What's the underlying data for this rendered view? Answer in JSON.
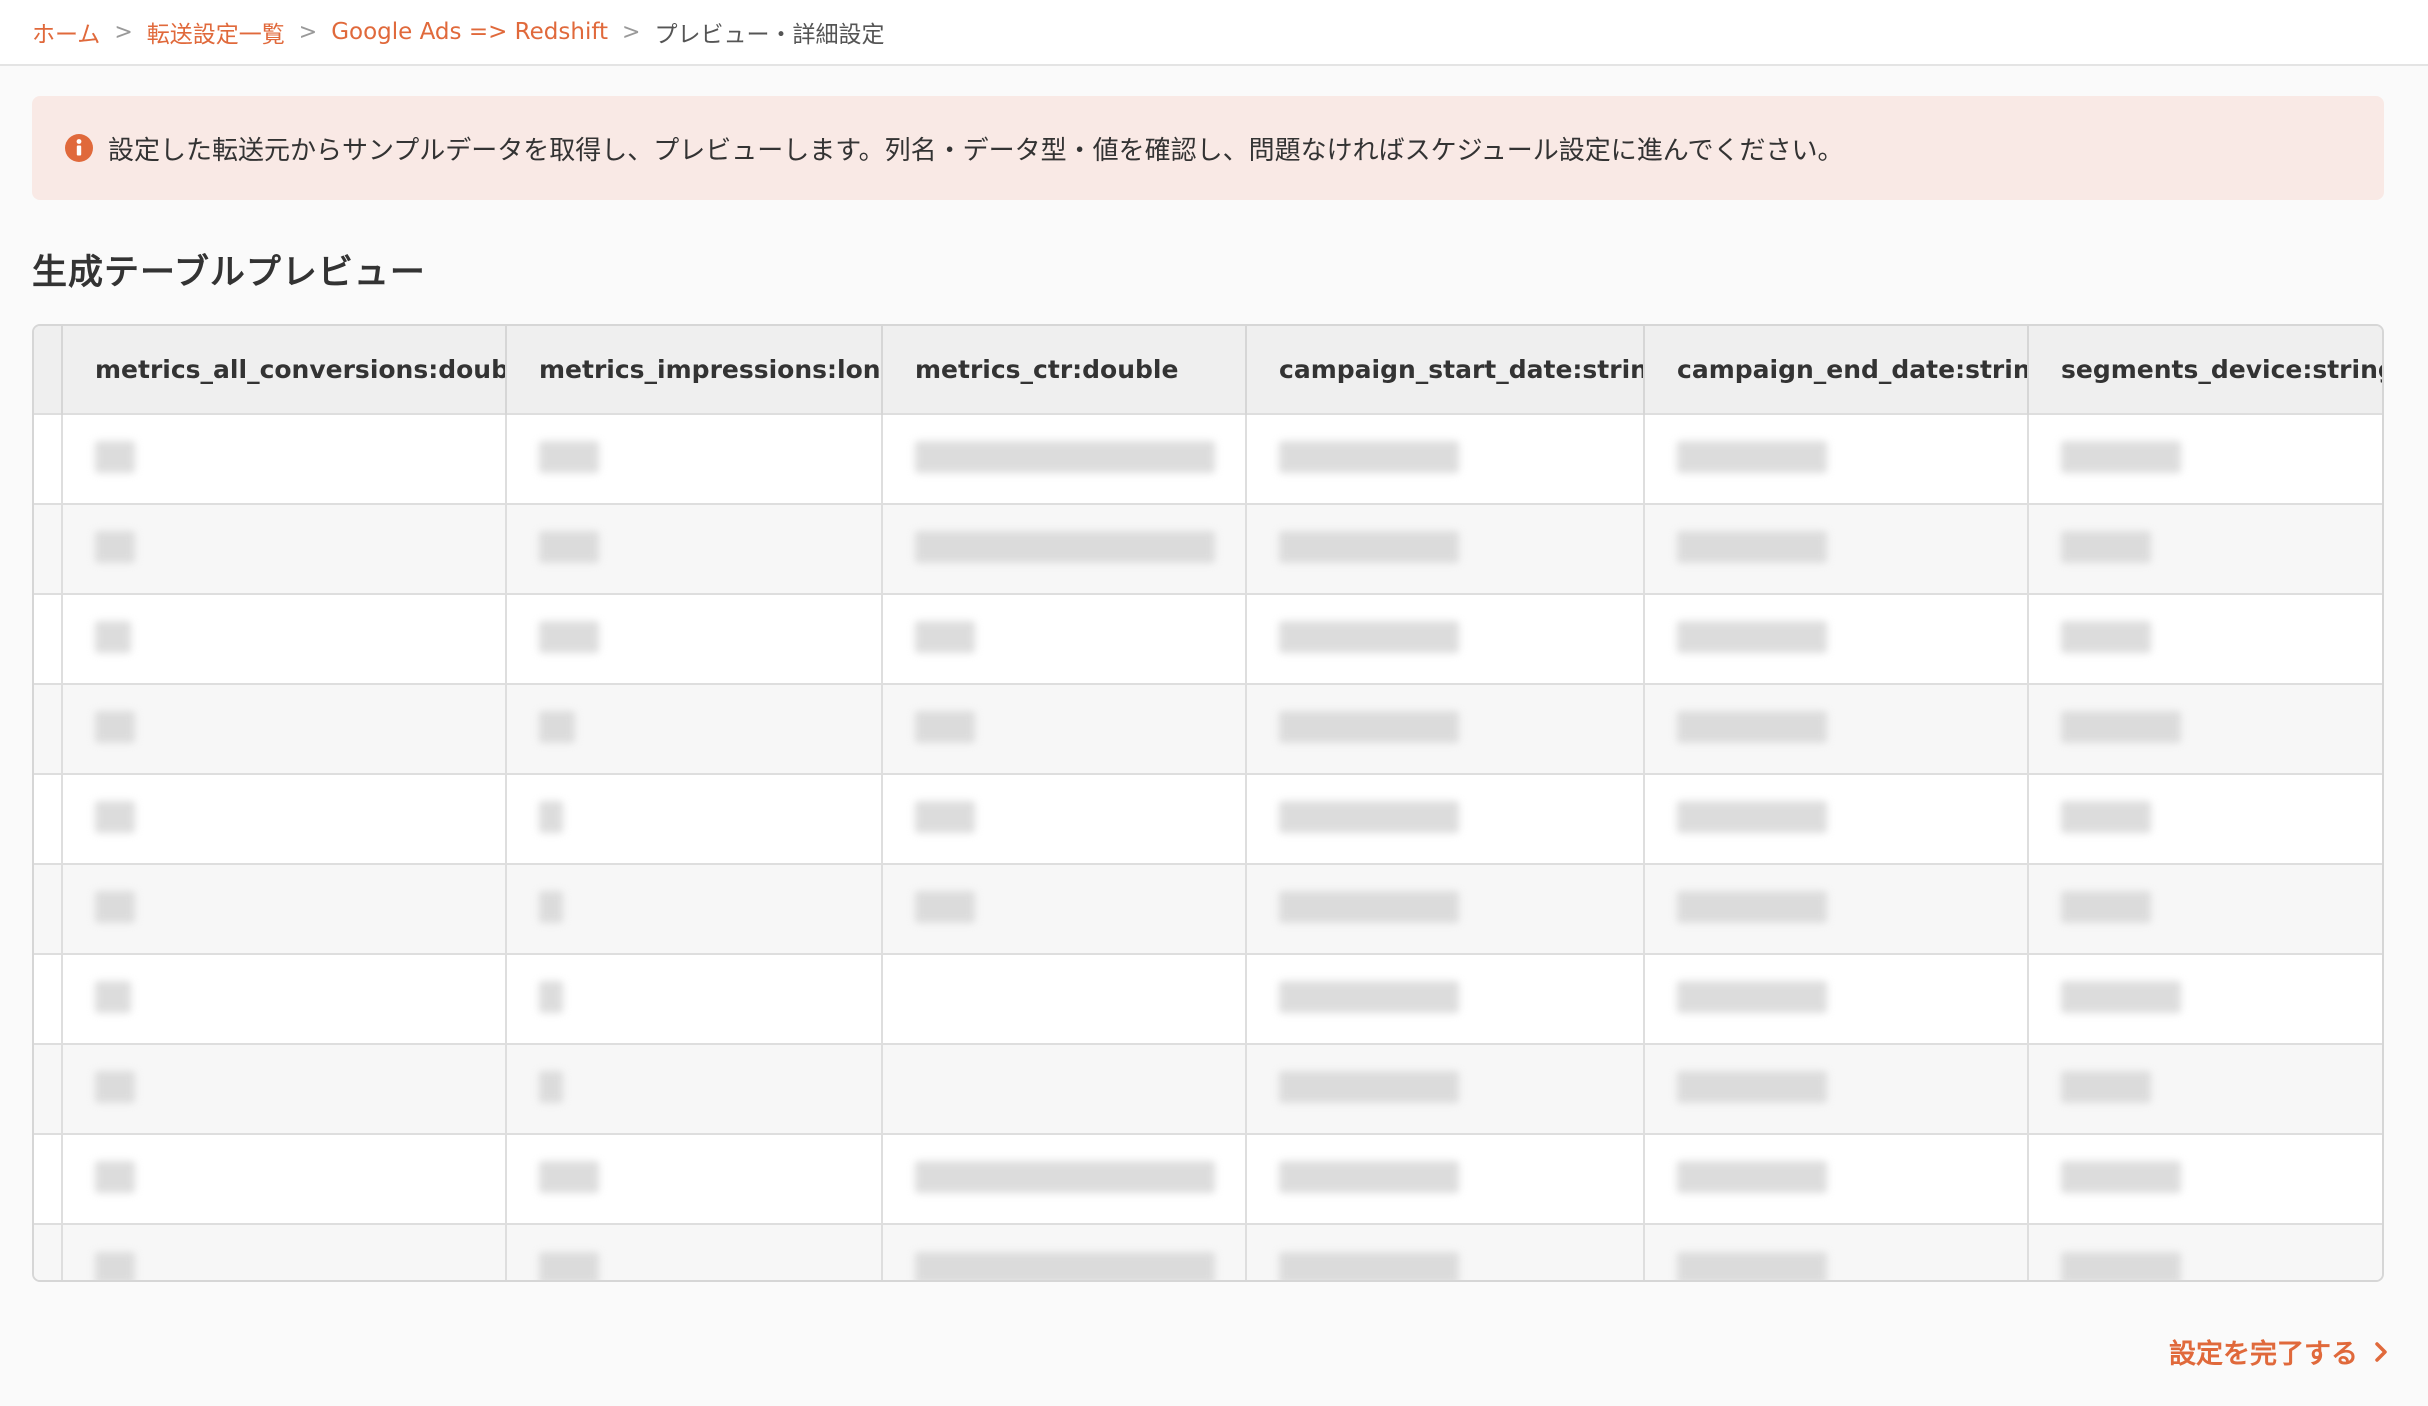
{
  "breadcrumb": {
    "items": [
      "ホーム",
      "転送設定一覧",
      "Google Ads => Redshift"
    ],
    "current": "プレビュー・詳細設定",
    "separator": ">"
  },
  "notice": {
    "icon": "info-icon",
    "text": "設定した転送元からサンプルデータを取得し、プレビューします。列名・データ型・値を確認し、問題なければスケジュール設定に進んでください。",
    "bg_color": "#f9e9e5",
    "icon_color": "#e0693b"
  },
  "preview": {
    "title": "生成テーブルプレビュー",
    "columns": [
      "metrics_all_conversions:double",
      "metrics_impressions:long",
      "metrics_ctr:double",
      "campaign_start_date:string",
      "campaign_end_date:string",
      "segments_device:string"
    ],
    "visible_row_count": 10,
    "cell_values": "pixelated-redacted"
  },
  "actions": {
    "finish_label": "設定を完了する",
    "accent_color": "#e0693b"
  }
}
